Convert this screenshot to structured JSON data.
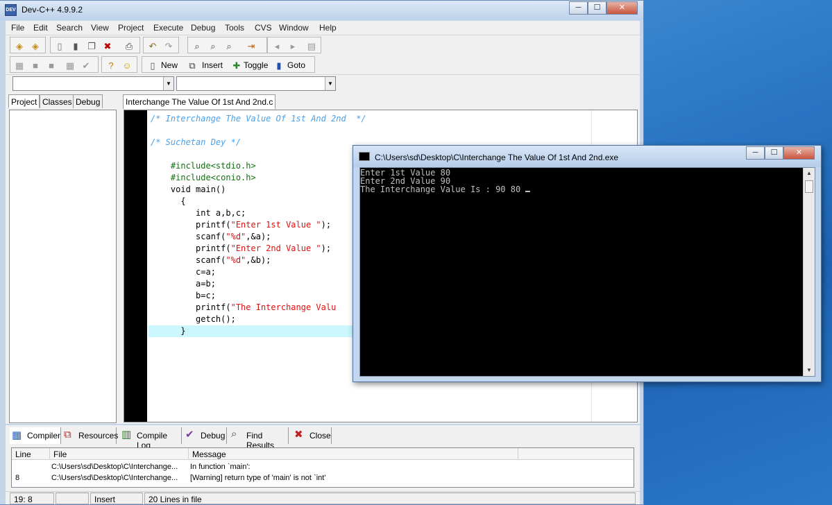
{
  "window": {
    "title": "Dev-C++ 4.9.9.2",
    "icon_label": "DEV",
    "controls": [
      "─",
      "☐",
      "✕"
    ]
  },
  "menu": [
    "File",
    "Edit",
    "Search",
    "View",
    "Project",
    "Execute",
    "Debug",
    "Tools",
    "CVS",
    "Window",
    "Help"
  ],
  "toolbar": {
    "new_label": "New",
    "insert_label": "Insert",
    "toggle_label": "Toggle",
    "goto_label": "Goto"
  },
  "left_tabs": [
    "Project",
    "Classes",
    "Debug"
  ],
  "editor": {
    "tab_label": "Interchange The Value Of 1st And 2nd.c",
    "lines": [
      {
        "parts": [
          {
            "t": "/* Interchange The Value Of 1st And 2nd  */",
            "c": "cmt"
          }
        ]
      },
      {
        "parts": []
      },
      {
        "parts": [
          {
            "t": "/* Suchetan Dey */",
            "c": "cmt"
          }
        ]
      },
      {
        "parts": []
      },
      {
        "parts": [
          {
            "t": "    "
          },
          {
            "t": "#include<stdio.h>",
            "c": "pp"
          }
        ]
      },
      {
        "parts": [
          {
            "t": "    "
          },
          {
            "t": "#include<conio.h>",
            "c": "pp"
          }
        ]
      },
      {
        "parts": [
          {
            "t": "    void main()"
          }
        ]
      },
      {
        "parts": [
          {
            "t": "      {"
          }
        ]
      },
      {
        "parts": [
          {
            "t": "         int a,b,c;"
          }
        ]
      },
      {
        "parts": [
          {
            "t": "         printf("
          },
          {
            "t": "\"Enter 1st Value \"",
            "c": "str"
          },
          {
            "t": ");"
          }
        ]
      },
      {
        "parts": [
          {
            "t": "         scanf("
          },
          {
            "t": "\"%d\"",
            "c": "str"
          },
          {
            "t": ",&a);"
          }
        ]
      },
      {
        "parts": [
          {
            "t": "         printf("
          },
          {
            "t": "\"Enter 2nd Value \"",
            "c": "str"
          },
          {
            "t": ");"
          }
        ]
      },
      {
        "parts": [
          {
            "t": "         scanf("
          },
          {
            "t": "\"%d\"",
            "c": "str"
          },
          {
            "t": ",&b);"
          }
        ]
      },
      {
        "parts": [
          {
            "t": "         c=a;"
          }
        ]
      },
      {
        "parts": [
          {
            "t": "         a=b;"
          }
        ]
      },
      {
        "parts": [
          {
            "t": "         b=c;"
          }
        ]
      },
      {
        "parts": [
          {
            "t": "         printf("
          },
          {
            "t": "\"The Interchange Valu",
            "c": "str"
          }
        ]
      },
      {
        "parts": [
          {
            "t": "         getch();"
          }
        ]
      },
      {
        "parts": [
          {
            "t": "      }"
          }
        ],
        "highlight": true
      }
    ]
  },
  "bottom_tabs": [
    "Compiler",
    "Resources",
    "Compile Log",
    "Debug",
    "Find Results",
    "Close"
  ],
  "messages": {
    "headers": [
      "Line",
      "File",
      "Message"
    ],
    "rows": [
      {
        "line": "",
        "file": "C:\\Users\\sd\\Desktop\\C\\Interchange...",
        "message": "In function `main':"
      },
      {
        "line": "8",
        "file": "C:\\Users\\sd\\Desktop\\C\\Interchange...",
        "message": "[Warning] return type of 'main' is not `int'"
      }
    ]
  },
  "status": {
    "position": "19: 8",
    "modified": "",
    "mode": "Insert",
    "lines": "20 Lines in file"
  },
  "console": {
    "title": "C:\\Users\\sd\\Desktop\\C\\Interchange The Value Of 1st And 2nd.exe",
    "lines": [
      "Enter 1st Value 80",
      "Enter 2nd Value 90",
      "The Interchange Value Is : 90 80 "
    ]
  }
}
